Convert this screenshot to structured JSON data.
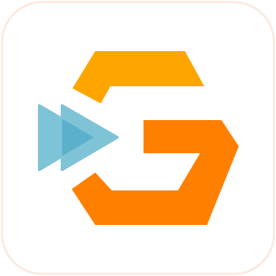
{
  "icon": {
    "name": "app-launcher-icon",
    "tile_color": "#ffffff",
    "tile_border_color": "#fbe9de",
    "g_upper_color": "#ffa500",
    "g_lower_color": "#ff8000",
    "arrow_back_color": "#7fc3d6",
    "arrow_front_color": "#5bb1cb"
  }
}
